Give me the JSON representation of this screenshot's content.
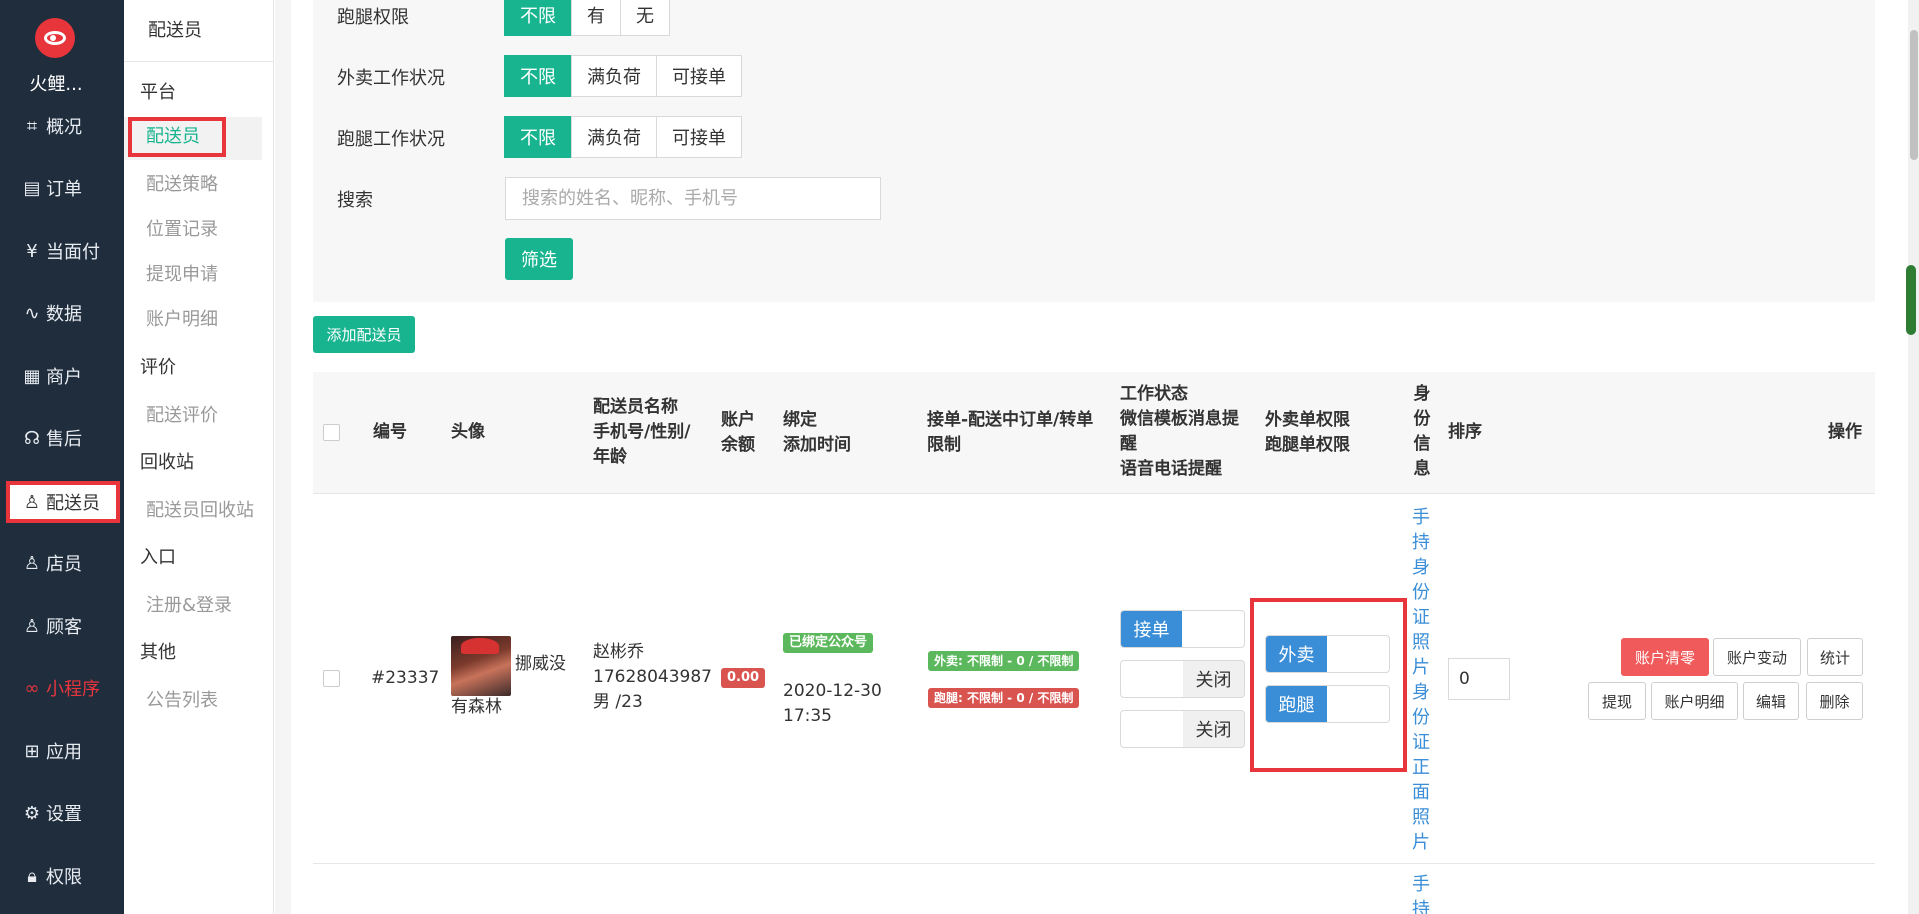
{
  "app": {
    "name": "火鲤..."
  },
  "nav": [
    {
      "label": "概况",
      "icon": "dashboard-icon"
    },
    {
      "label": "订单",
      "icon": "order-icon"
    },
    {
      "label": "当面付",
      "icon": "yen-icon"
    },
    {
      "label": "数据",
      "icon": "chart-icon"
    },
    {
      "label": "商户",
      "icon": "store-icon"
    },
    {
      "label": "售后",
      "icon": "service-icon"
    },
    {
      "label": "配送员",
      "icon": "user-icon"
    },
    {
      "label": "店员",
      "icon": "user-icon"
    },
    {
      "label": "顾客",
      "icon": "user-icon"
    },
    {
      "label": "小程序",
      "icon": "miniapp-icon"
    },
    {
      "label": "应用",
      "icon": "apps-icon"
    },
    {
      "label": "设置",
      "icon": "gear-icon"
    },
    {
      "label": "权限",
      "icon": "lock-icon"
    }
  ],
  "subnav": {
    "title": "配送员",
    "groups": [
      "平台",
      "评价",
      "回收站",
      "入口",
      "其他"
    ],
    "links": [
      "配送员",
      "配送策略",
      "位置记录",
      "提现申请",
      "账户明细",
      "配送评价",
      "配送员回收站",
      "注册&登录",
      "公告列表"
    ]
  },
  "filter": {
    "paotui_perm": {
      "label": "跑腿权限",
      "options": [
        "不限",
        "有",
        "无"
      ]
    },
    "waimai_status": {
      "label": "外卖工作状况",
      "options": [
        "不限",
        "满负荷",
        "可接单"
      ]
    },
    "paotui_status": {
      "label": "跑腿工作状况",
      "options": [
        "不限",
        "满负荷",
        "可接单"
      ]
    },
    "search": {
      "label": "搜索",
      "placeholder": "搜索的姓名、昵称、手机号"
    },
    "submit": "筛选"
  },
  "add_button": "添加配送员",
  "table": {
    "headers": {
      "id": "编号",
      "avatar": "头像",
      "name": [
        "配送员名称",
        "手机号/性别/",
        "年龄"
      ],
      "balance": [
        "账户",
        "余额"
      ],
      "bind": [
        "绑定",
        "添加时间"
      ],
      "limit": [
        "接单-配送中订单/转单",
        "限制"
      ],
      "status": [
        "工作状态",
        "微信模板消息提",
        "醒",
        "语音电话提醒"
      ],
      "perm": [
        "外卖单权限",
        "跑腿单权限"
      ],
      "idinfo": [
        "身",
        "份",
        "信",
        "息"
      ],
      "sort": "排序",
      "ops": "操作"
    },
    "row": {
      "id": "#23337",
      "nickname": [
        "挪威没",
        "有森林"
      ],
      "name": "赵彬乔",
      "phone": "17628043987",
      "gender_age": "男 /23",
      "balance": "0.00",
      "bind_badge": "已绑定公众号",
      "add_time": [
        "2020-12-30",
        "17:35"
      ],
      "limit_waimai": "外卖:  不限制 - 0 / 不限制",
      "limit_paotui": "跑腿:  不限制 - 0 / 不限制",
      "work_toggle": "接单",
      "wechat_toggle": "关闭",
      "voice_toggle": "关闭",
      "perm_waimai": "外卖",
      "perm_paotui": "跑腿",
      "id_info": [
        "手",
        "持",
        "身",
        "份",
        "证",
        "照",
        "片",
        "身",
        "份",
        "证",
        "正",
        "面",
        "照",
        "片"
      ],
      "sort": "0",
      "ops": {
        "clear": "账户清零",
        "change": "账户变动",
        "stats": "统计",
        "withdraw": "提现",
        "detail": "账户明细",
        "edit": "编辑",
        "delete": "删除"
      }
    },
    "next_row_partial": [
      "手",
      "持"
    ]
  },
  "colors": {
    "accent": "#18b48f",
    "sidebar": "#1f2d3d",
    "danger": "#e8353c",
    "blue": "#3a8ed8"
  }
}
